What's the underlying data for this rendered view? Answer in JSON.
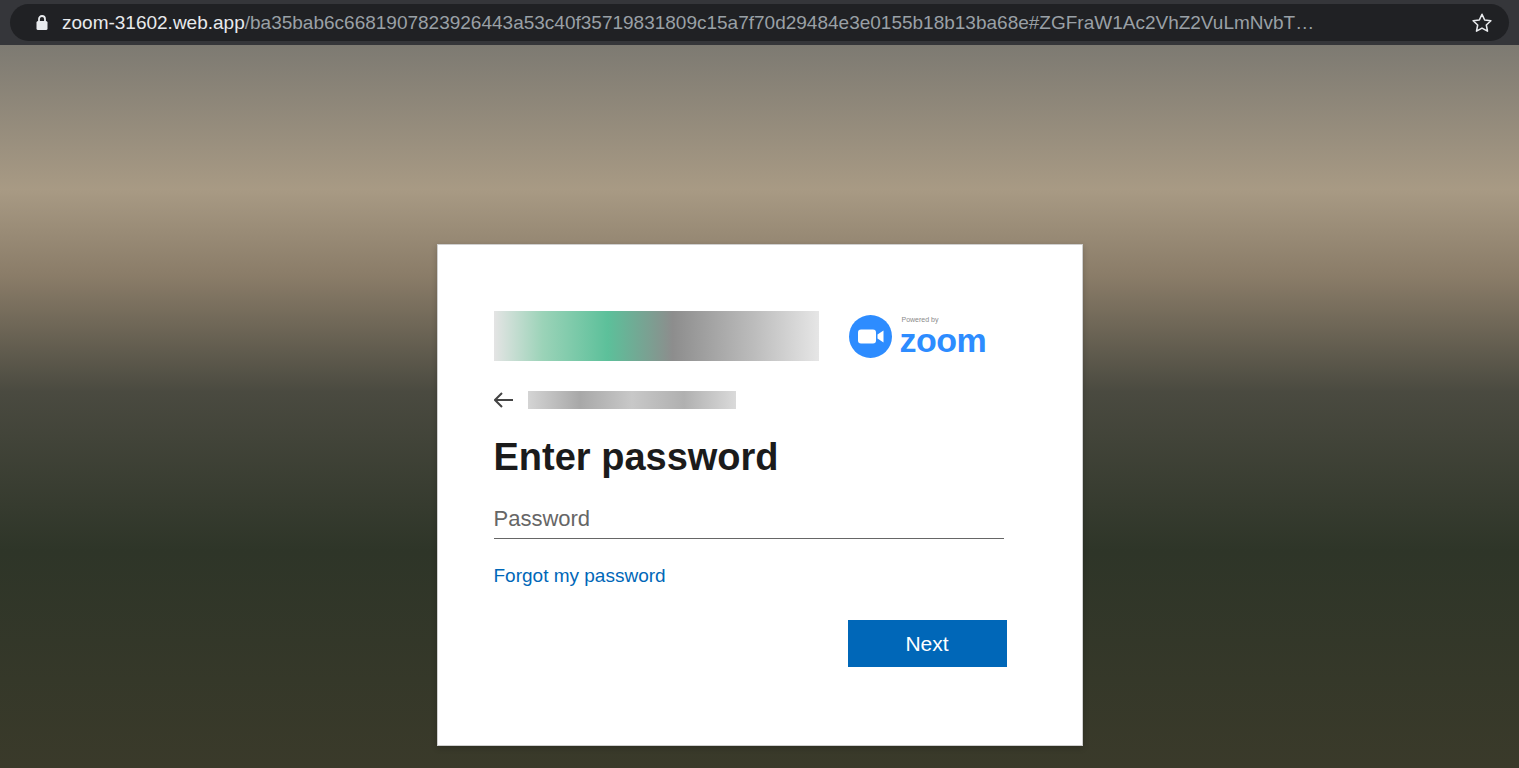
{
  "browser": {
    "url_host": "zoom-31602.web.app",
    "url_path": "/ba35bab6c6681907823926443a53c40f35719831809c15a7f70d29484e3e0155b18b13ba68e#ZGFraW1Ac2VhZ2VuLmNvbT…"
  },
  "card": {
    "powered_by": "Powered by",
    "brand": "zoom",
    "heading": "Enter password",
    "password_placeholder": "Password",
    "forgot_link": "Forgot my password",
    "next_button": "Next"
  }
}
